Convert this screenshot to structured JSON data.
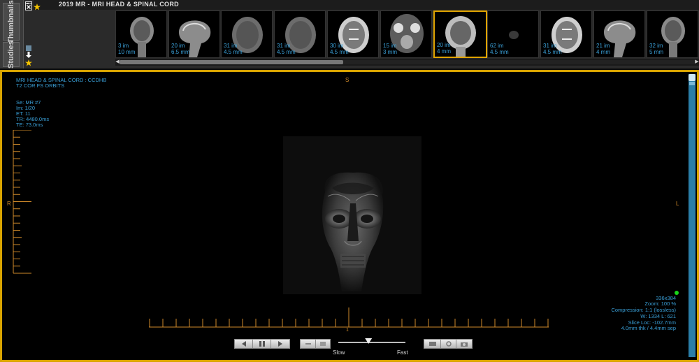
{
  "window": {
    "title": "2019   MR - MRI HEAD &  SPINAL CORD"
  },
  "tabs": {
    "thumbnails": "Thumbnails",
    "studies": "Studies"
  },
  "thumbnails": [
    {
      "line1": "3 im",
      "line2": "10 mm",
      "kind": "cor"
    },
    {
      "line1": "20 im",
      "line2": "6.5 mm",
      "kind": "sag"
    },
    {
      "line1": "31 im",
      "line2": "4.5 mm",
      "kind": "ax-dark"
    },
    {
      "line1": "31 im",
      "line2": "4.5 mm",
      "kind": "ax-dark"
    },
    {
      "line1": "30 im",
      "line2": "4.5 mm",
      "kind": "ax-bright"
    },
    {
      "line1": "15 im",
      "line2": "3 mm",
      "kind": "ax-base"
    },
    {
      "line1": "20 im",
      "line2": "4 mm",
      "kind": "face",
      "active": true
    },
    {
      "line1": "62 im",
      "line2": "4.5 mm",
      "kind": "dim"
    },
    {
      "line1": "31 im",
      "line2": "4.5 mm",
      "kind": "ax-bright"
    },
    {
      "line1": "21 im",
      "line2": "4 mm",
      "kind": "sag"
    },
    {
      "line1": "32 im",
      "line2": "5 mm",
      "kind": "cor"
    }
  ],
  "overlay": {
    "study": "MRI HEAD &  SPINAL CORD : CCDHB",
    "series_desc": "T2 COR FS ORBITS",
    "se": "Se: MR #7",
    "im": "Im: 1/20",
    "et": "ET: 11",
    "tr": "TR: 4480.0ms",
    "te": "TE: 73.0ms",
    "orient_top": "S",
    "orient_left": "R",
    "orient_right": "L",
    "ruler_mid": "1",
    "matrix": "336x384",
    "zoom": "Zoom: 100 %",
    "compression": "Compression: 1:1 (lossless)",
    "wl": "W: 1334 L: 621",
    "slice_loc": "Slice Loc: -102.7mm",
    "thickness": "4.0mm thk / 4.4mm sep"
  },
  "playback": {
    "slow": "Slow",
    "fast": "Fast",
    "speed_fraction": 0.45
  },
  "colors": {
    "accent": "#d9a400",
    "overlay_text": "#3aa0d8",
    "ruler": "#d08a2a"
  },
  "icons": {
    "layout": "layout-icon",
    "close": "close-icon",
    "favorite": "star-icon",
    "download": "download-icon"
  }
}
